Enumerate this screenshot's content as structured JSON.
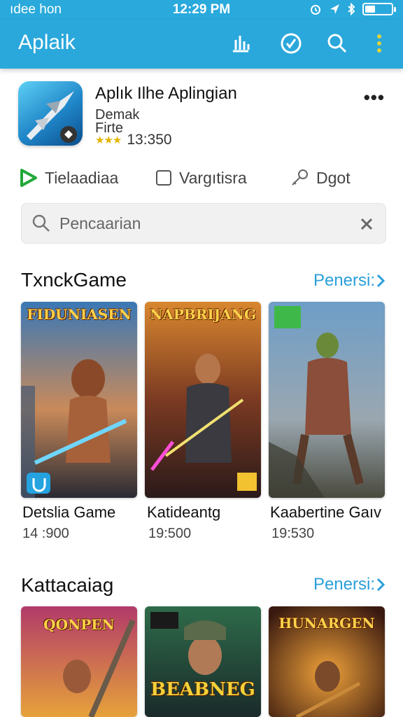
{
  "status": {
    "carrier": "ıdee hon",
    "time": "12:29 PM"
  },
  "appbar": {
    "title": "Aplaik"
  },
  "app": {
    "title": "Aplık Ilhe Aplingian",
    "developer": "Demak",
    "category": "Firte",
    "stars": "★★★",
    "rating": "13:350"
  },
  "actions": [
    {
      "label": "Tielaadiaa",
      "icon": "play-triangle-icon"
    },
    {
      "label": "Vargıtisra",
      "icon": "checkbox-icon"
    },
    {
      "label": "Dgot",
      "icon": "key-icon"
    }
  ],
  "search": {
    "placeholder": "Pencaarian"
  },
  "sections": [
    {
      "title": "TxnckGame",
      "link": "Penersi:",
      "games": [
        {
          "name": "Detslia Game",
          "meta": "14 :900",
          "art_title": "FIDUNIASEN",
          "colors": [
            "#1f4f8a",
            "#d0703a",
            "#2b2a33"
          ]
        },
        {
          "name": "Katideantg",
          "meta": "19:500",
          "art_title": "NAPBRIJANG",
          "colors": [
            "#8a3d1a",
            "#e2a045",
            "#2b1a1a"
          ]
        },
        {
          "name": "Kaabertine Gaıv",
          "meta": "19:530",
          "art_title": "",
          "colors": [
            "#3d6f9e",
            "#c6a982",
            "#4a3e3a"
          ]
        }
      ]
    },
    {
      "title": "Kattacaiag",
      "link": "Penersi:",
      "games": [
        {
          "art_title": "QONPEN",
          "colors": [
            "#8c2d5c",
            "#e6a23a",
            "#3a1a30"
          ]
        },
        {
          "art_title": "BEABNEG",
          "colors": [
            "#2e6b4a",
            "#e2c43c",
            "#1a2a2a"
          ]
        },
        {
          "art_title": "HUNARGEN",
          "colors": [
            "#4a2a1a",
            "#f08a2a",
            "#1a1010"
          ]
        }
      ]
    }
  ]
}
